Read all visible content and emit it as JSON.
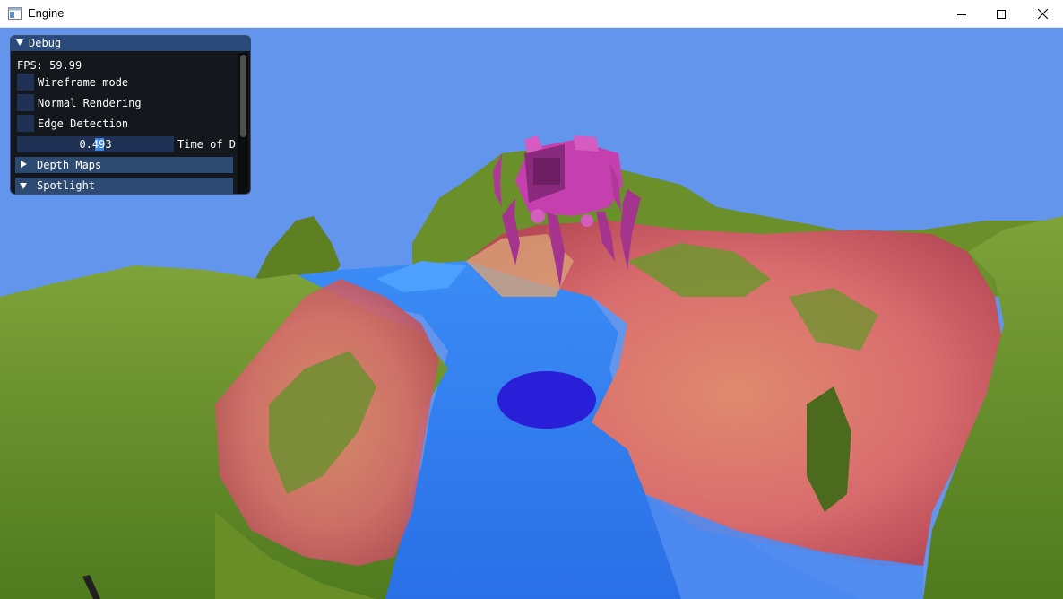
{
  "window": {
    "title": "Engine"
  },
  "icons": {
    "app": "app-window-icon",
    "minimize": "minimize-icon",
    "maximize": "maximize-icon",
    "close": "close-icon"
  },
  "debug_panel": {
    "title": "Debug",
    "fps": "FPS: 59.99",
    "checkboxes": [
      {
        "label": "Wireframe mode",
        "checked": false
      },
      {
        "label": "Normal Rendering",
        "checked": false
      },
      {
        "label": "Edge Detection",
        "checked": false
      }
    ],
    "slider": {
      "value": "0.493",
      "label": "Time of D"
    },
    "sections": [
      {
        "label": "Depth Maps",
        "expanded": false
      },
      {
        "label": "Spotlight",
        "expanded": true
      }
    ]
  },
  "colors": {
    "sky": "#6495ed",
    "water": "#2e7df5",
    "grass": "#6d8f2a",
    "rock": "#d86a6a",
    "robot": "#c23ca8",
    "imgui_bg": "#0f0f0f",
    "imgui_header": "#294a7a",
    "imgui_frame": "#1f3255"
  }
}
